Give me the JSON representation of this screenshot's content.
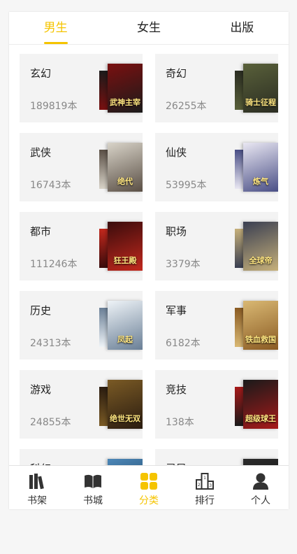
{
  "tabs": [
    {
      "label": "男生",
      "active": true
    },
    {
      "label": "女生",
      "active": false
    },
    {
      "label": "出版",
      "active": false
    }
  ],
  "categories": [
    {
      "name": "玄幻",
      "count": "189819本",
      "cover_text": "武神主宰",
      "cover_colors": [
        "#7a1010",
        "#1b1b1b"
      ]
    },
    {
      "name": "奇幻",
      "count": "26255本",
      "cover_text": "骑士征程",
      "cover_colors": [
        "#59603a",
        "#2b2d22"
      ]
    },
    {
      "name": "武侠",
      "count": "16743本",
      "cover_text": "绝代",
      "cover_colors": [
        "#d8d3c8",
        "#5a4f45"
      ]
    },
    {
      "name": "仙侠",
      "count": "53995本",
      "cover_text": "炼气",
      "cover_colors": [
        "#e9e7f2",
        "#4a4f86"
      ]
    },
    {
      "name": "都市",
      "count": "111246本",
      "cover_text": "狂王殿",
      "cover_colors": [
        "#3a0c0c",
        "#c2281d"
      ]
    },
    {
      "name": "职场",
      "count": "3379本",
      "cover_text": "全球帝",
      "cover_colors": [
        "#3a3f52",
        "#c6b07a"
      ]
    },
    {
      "name": "历史",
      "count": "24313本",
      "cover_text": "凤起",
      "cover_colors": [
        "#eef3f7",
        "#6a7f96"
      ]
    },
    {
      "name": "军事",
      "count": "6182本",
      "cover_text": "铁血救国",
      "cover_colors": [
        "#d9b873",
        "#8a5b23"
      ]
    },
    {
      "name": "游戏",
      "count": "24855本",
      "cover_text": "绝世无双",
      "cover_colors": [
        "#7a5a25",
        "#2a1c10"
      ]
    },
    {
      "name": "竞技",
      "count": "138本",
      "cover_text": "超级球王",
      "cover_colors": [
        "#1a1a1a",
        "#a71a1a"
      ]
    },
    {
      "name": "科幻",
      "count": "",
      "cover_text": "",
      "cover_colors": [
        "#4c87b8",
        "#14344e"
      ]
    },
    {
      "name": "灵异",
      "count": "",
      "cover_text": "",
      "cover_colors": [
        "#2b2b2b",
        "#111111"
      ]
    }
  ],
  "bottom_nav": [
    {
      "label": "书架",
      "icon": "bookshelf-icon",
      "active": false
    },
    {
      "label": "书城",
      "icon": "open-book-icon",
      "active": false
    },
    {
      "label": "分类",
      "icon": "category-grid-icon",
      "active": true
    },
    {
      "label": "排行",
      "icon": "ranking-podium-icon",
      "active": false
    },
    {
      "label": "个人",
      "icon": "person-icon",
      "active": false
    }
  ],
  "colors": {
    "accent": "#f5c400",
    "card_bg": "#f3f3f3",
    "text": "#222222",
    "muted": "#888888"
  }
}
